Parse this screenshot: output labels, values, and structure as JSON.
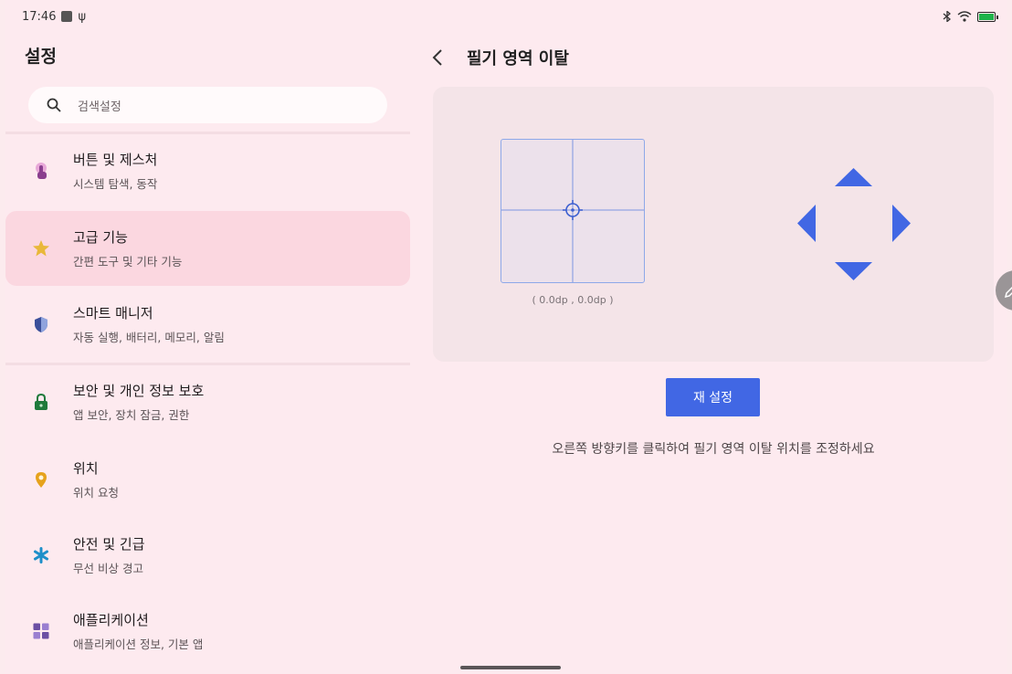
{
  "status_bar": {
    "time": "17:46",
    "usb_glyph": "ψ"
  },
  "settings": {
    "title": "설정",
    "search_placeholder": "검색설정",
    "items": [
      {
        "title": "버튼 및 제스처",
        "subtitle": "시스템 탐색, 동작",
        "icon": "touch-icon",
        "color": "#8a3f8e"
      },
      {
        "title": "고급 기능",
        "subtitle": "간편 도구 및 기타 기능",
        "icon": "star-icon",
        "color": "#e0b43a"
      },
      {
        "title": "스마트 매니저",
        "subtitle": "자동 실행, 배터리, 메모리, 알림",
        "icon": "shield-icon",
        "color": "#3a4f9a"
      },
      {
        "title": "보안 및 개인 정보 보호",
        "subtitle": "앱 보안, 장치 잠금, 권한",
        "icon": "lock-icon",
        "color": "#1f7a3c"
      },
      {
        "title": "위치",
        "subtitle": "위치 요청",
        "icon": "location-icon",
        "color": "#e6a21c"
      },
      {
        "title": "안전 및 긴급",
        "subtitle": "무선 비상 경고",
        "icon": "asterisk-icon",
        "color": "#1d8fc9"
      },
      {
        "title": "애플리케이션",
        "subtitle": "애플리케이션 정보, 기본 앱",
        "icon": "apps-icon",
        "color": "#6b4fa3"
      }
    ]
  },
  "detail": {
    "title": "필기 영역 이탈",
    "coordinates": "( 0.0dp , 0.0dp )",
    "reset_label": "재 설정",
    "hint": "오른쪽 방향키를 클릭하여 필기 영역 이탈 위치를 조정하세요"
  },
  "colors": {
    "accent": "#4167e4",
    "background": "#fdeaef",
    "active_item": "#fbd7e0",
    "card": "#f4e4e8"
  }
}
